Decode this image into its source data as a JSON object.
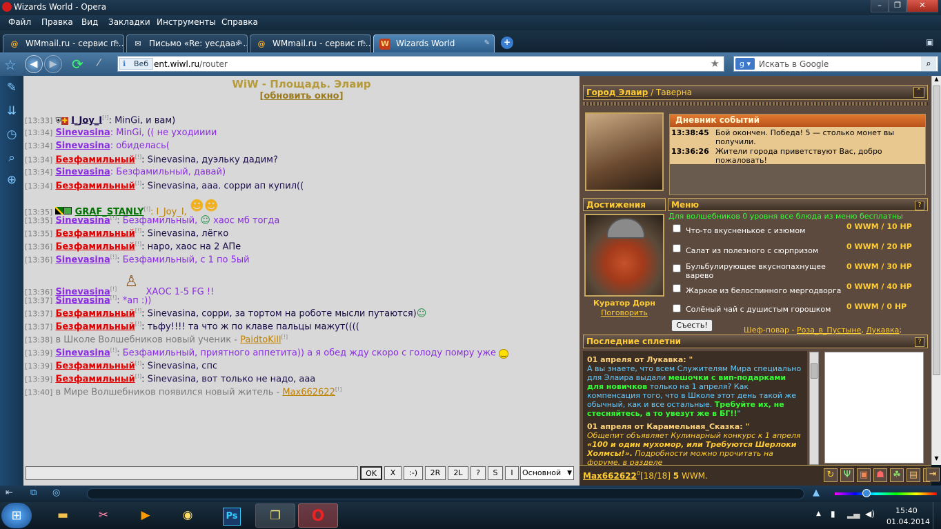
{
  "window": {
    "title": "Wizards World - Opera"
  },
  "menu": [
    "Файл",
    "Правка",
    "Вид",
    "Закладки",
    "Инструменты",
    "Справка"
  ],
  "tabs": [
    {
      "label": "WMmail.ru - сервис п..."
    },
    {
      "label": "Письмо «Re: уесдаа» ..."
    },
    {
      "label": "WMmail.ru - сервис п..."
    },
    {
      "label": "Wizards World"
    }
  ],
  "address": {
    "prefix": "Веб",
    "host": "ent.wiwl.ru",
    "path": "/router"
  },
  "search": {
    "placeholder": "Искать в Google"
  },
  "chat": {
    "title": "WiW - Площадь. Элаир",
    "refresh": "обновить окно",
    "messages": [
      {
        "time": "[13:33]",
        "nick": "I_Joy_I",
        "text": ": MinGi, и вам)"
      },
      {
        "time": "[13:34]",
        "nick": "Sinevasina",
        "text": ": MinGi, (( не уходииии"
      },
      {
        "time": "[13:34]",
        "nick": "Sinevasina",
        "text": ": обиделась("
      },
      {
        "time": "[13:34]",
        "nick": "Безфамильный",
        "text": ": Sinevasina, дуэльку дадим?"
      },
      {
        "time": "[13:34]",
        "nick": "Sinevasina",
        "text": ": Безфамильный, давай)"
      },
      {
        "time": "[13:34]",
        "nick": "Безфамильный",
        "text": ": Sinevasina, ааа. сорри ап купил(("
      },
      {
        "time": "[13:35]",
        "nick": "GRAF_STANLY",
        "text": ": I_Joy_I,"
      },
      {
        "time": "[13:35]",
        "nick": "Sinevasina",
        "text": ": Безфамильный,",
        "text2": " хаос мб тогда"
      },
      {
        "time": "[13:35]",
        "nick": "Безфамильный",
        "text": ": Sinevasina, лёгко"
      },
      {
        "time": "[13:36]",
        "nick": "Безфамильный",
        "text": ": наро, хаос на 2 АПе"
      },
      {
        "time": "[13:36]",
        "nick": "Sinevasina",
        "text": ": Безфамильный, с 1 по 5ый"
      },
      {
        "time": "[13:36]",
        "nick": "Sinevasina",
        "text": "ХАОС 1-5 FG !!"
      },
      {
        "time": "[13:37]",
        "nick": "Sinevasina",
        "text": ": *ап :))"
      },
      {
        "time": "[13:37]",
        "nick": "Безфамильный",
        "text": ": Sinevasina, сорри, за тортом на роботе мысли путаются)"
      },
      {
        "time": "[13:37]",
        "nick": "Безфамильный",
        "text": ": тьфу!!!! та что ж по клаве пальцы мажут(((("
      },
      {
        "time": "[13:38]",
        "text": "в Школе Волшебников новый ученик - ",
        "nick": "PaidtoKill"
      },
      {
        "time": "[13:39]",
        "nick": "Sinevasina",
        "text": ": Безфамильный, приятного аппетита)) а я обед жду скоро с голоду помру уже"
      },
      {
        "time": "[13:39]",
        "nick": "Безфамильный",
        "text": ": Sinevasina, спс"
      },
      {
        "time": "[13:39]",
        "nick": "Безфамильный",
        "text": ": Sinevasina, вот только не надо, ааа"
      },
      {
        "time": "[13:40]",
        "text": "в Мире Волшебников появился новый житель - ",
        "nick": "Max662622"
      }
    ],
    "sup": "[!]",
    "buttons": {
      "ok": "OK",
      "x": "X",
      "smile": ":-)",
      "r2": "2R",
      "l2": "2L",
      "q": "?",
      "s": "S",
      "i": "I"
    },
    "channel": "Основной"
  },
  "location": {
    "city": "Город Элаир",
    "sep": " / ",
    "place": "Таверна"
  },
  "diary": {
    "title": "Дневник событий",
    "events": [
      {
        "time": "13:38:45",
        "text": "Бой окончен. Победа! 5 — столько монет вы получили."
      },
      {
        "time": "13:36:26",
        "text": "Жители города приветствуют Вас, добро пожаловать!"
      }
    ]
  },
  "achievements": {
    "title": "Достижения",
    "curator": "Куратор Дорн",
    "talk": "Поговорить"
  },
  "food": {
    "title": "Меню",
    "note": "Для волшебников 0 уровня все блюда из меню бесплатны",
    "items": [
      {
        "name": "Что-то вкусненькое с изюмом",
        "price": "0 WWM / 10 HP"
      },
      {
        "name": "Салат из полезного с сюрпризом",
        "price": "0 WWM / 20 HP"
      },
      {
        "name": "Бульбулирующее вкуснопахнущее варево",
        "price": "0 WWM / 30 HP"
      },
      {
        "name": "Жаркое из белоспинного мергодворга",
        "price": "0 WWM / 40 HP"
      },
      {
        "name": "Солёный чай с душистым горошком",
        "price": "0 WWM / 0 HP"
      }
    ],
    "eat": "Съесть!",
    "chef_label": "Шеф-повар - ",
    "chef1": "Роза_в_Пустыне",
    "chef2": "Лукавка",
    "chef_end": ";"
  },
  "gossip": {
    "title": "Последние сплетни",
    "g1_head": "01 апреля от Лукавка:",
    "g1_text1": "А вы знаете, что всем Служителям Мира специально для Элаира выдали ",
    "g1_bold1": "мешочки с вип-подарками для новичков",
    "g1_text2": " только на 1 апреля? Как компенсация того, что в Школе этот день такой же обычный, как и все остальные. ",
    "g1_bold2": "Требуйте их, не стесняйтесь, а то увезут же в БГ!!",
    "g2_head": "01 апреля от Карамельная_Сказка:",
    "g2_text1": "Общепит объявляет Кулинарный конкурс к 1 апреля ",
    "g2_bold": "«100 и один мухомор, или Требуются Шерлоки Холмсы!».",
    "g2_text2": " Подробности можно прочитать на форуме, в разделе"
  },
  "status": {
    "nick": "Max662622",
    "level": "0",
    "hp": "[18/18]",
    "money": "5",
    "money_unit": "WWM."
  },
  "clock": {
    "time": "15:40",
    "date": "01.04.2014"
  },
  "colors": {
    "accent": "#ffcc33",
    "brand": "#8a2be2",
    "danger": "#e00000"
  }
}
